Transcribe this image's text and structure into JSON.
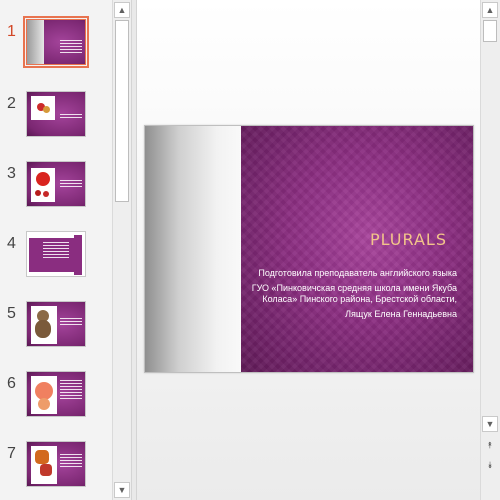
{
  "thumbnails": [
    {
      "number": "1",
      "selected": true
    },
    {
      "number": "2",
      "selected": false
    },
    {
      "number": "3",
      "selected": false
    },
    {
      "number": "4",
      "selected": false
    },
    {
      "number": "5",
      "selected": false
    },
    {
      "number": "6",
      "selected": false
    },
    {
      "number": "7",
      "selected": false
    }
  ],
  "scroll": {
    "up_glyph": "▲",
    "down_glyph": "▼",
    "prev_slide_glyph": "⯭",
    "next_slide_glyph": "⯯"
  },
  "slide": {
    "title": "PLURALS",
    "lines": [
      "Подготовила преподаватель английского языка",
      "ГУО «Пинковичская средняя школа имени Якуба Коласа» Пинского района, Брестской области,",
      "Лящук Елена Геннадьевна"
    ]
  },
  "colors": {
    "accent": "#d24726",
    "slide_purple": "#8a2d80",
    "title_gold": "#f2c48a"
  }
}
